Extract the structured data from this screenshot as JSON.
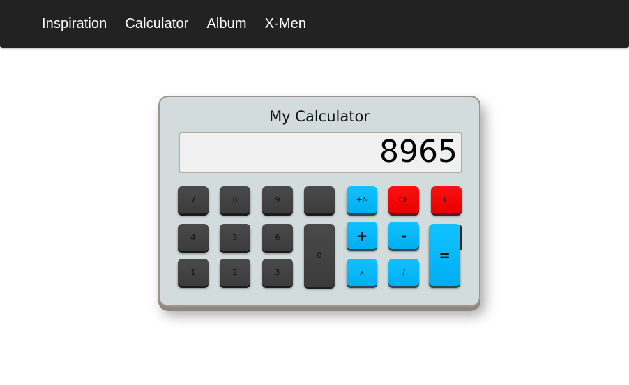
{
  "nav": {
    "items": [
      {
        "label": "Inspiration"
      },
      {
        "label": "Calculator"
      },
      {
        "label": "Album"
      },
      {
        "label": "X-Men"
      }
    ]
  },
  "calculator": {
    "title": "My Calculator",
    "display_value": "8965",
    "keys": {
      "seven": "7",
      "eight": "8",
      "nine": "9",
      "dot": ".",
      "plus_minus": "+/-",
      "ce": "CE",
      "c": "C",
      "four": "4",
      "five": "5",
      "six": "6",
      "plus": "+",
      "minus": "-",
      "one": "1",
      "two": "2",
      "three": "3",
      "zero": "0",
      "multiply": "x",
      "divide": "/",
      "equals": "="
    }
  },
  "colors": {
    "navbar": "#222222",
    "calculator_body": "#d3dcdd",
    "dark_key": "#3f3f3f",
    "blue_key": "#00b6f6",
    "red_key": "#ff0000"
  }
}
